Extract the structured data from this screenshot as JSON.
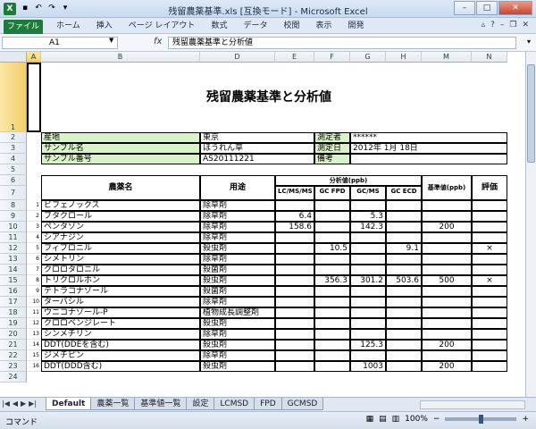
{
  "window": {
    "title": "残留農薬基準.xls [互換モード] - Microsoft Excel",
    "app_icon": "X"
  },
  "ribbon": {
    "file": "ファイル",
    "tabs": [
      "ホーム",
      "挿入",
      "ページ レイアウト",
      "数式",
      "データ",
      "校閲",
      "表示",
      "開発"
    ]
  },
  "formula_bar": {
    "cell_ref": "A1",
    "fx": "fx",
    "content": "残留農薬基準と分析値"
  },
  "columns": [
    "A",
    "B",
    "D",
    "E",
    "F",
    "G",
    "H",
    "M",
    "N"
  ],
  "rows": [
    "1",
    "2",
    "3",
    "4",
    "5",
    "6",
    "7",
    "8",
    "9",
    "10",
    "11",
    "12",
    "13",
    "14",
    "15",
    "16",
    "17",
    "18",
    "19",
    "20",
    "21",
    "22",
    "23",
    "24"
  ],
  "sheet": {
    "title": "残留農薬基準と分析値",
    "info": {
      "origin_label": "産地",
      "origin": "東京",
      "measurer_label": "測定者",
      "measurer": "******",
      "sample_name_label": "サンプル名",
      "sample_name": "ほうれん草",
      "date_label": "測定日",
      "date": "2012年  1月  18日",
      "sample_no_label": "サンプル番号",
      "sample_no": "AS20111221",
      "remarks_label": "備考",
      "remarks": ""
    },
    "headers": {
      "pesticide": "農薬名",
      "usage": "用途",
      "analysis": "分析値(ppb)",
      "lcms": "LC/MS/MS",
      "gcfpd": "GC FPD",
      "gcms": "GC/MS",
      "gcecd": "GC ECD",
      "standard": "基準値(ppb)",
      "evaluation": "評価"
    },
    "items": [
      {
        "no": "1",
        "name": "ビフェノックス",
        "usage": "除草剤",
        "lcms": "",
        "gcfpd": "",
        "gcms": "",
        "gcecd": "",
        "std": "",
        "eval": ""
      },
      {
        "no": "2",
        "name": "ブタクロール",
        "usage": "除草剤",
        "lcms": "6.4",
        "gcfpd": "",
        "gcms": "5.3",
        "gcecd": "",
        "std": "",
        "eval": ""
      },
      {
        "no": "3",
        "name": "ペンタゾン",
        "usage": "除草剤",
        "lcms": "158.6",
        "gcfpd": "",
        "gcms": "142.3",
        "gcecd": "",
        "std": "200",
        "eval": ""
      },
      {
        "no": "4",
        "name": "シアナジン",
        "usage": "除草剤",
        "lcms": "",
        "gcfpd": "",
        "gcms": "",
        "gcecd": "",
        "std": "",
        "eval": ""
      },
      {
        "no": "5",
        "name": "フィプロニル",
        "usage": "殺虫剤",
        "lcms": "",
        "gcfpd": "10.5",
        "gcms": "",
        "gcecd": "9.1",
        "std": "",
        "eval": "×"
      },
      {
        "no": "6",
        "name": "シメトリン",
        "usage": "除草剤",
        "lcms": "",
        "gcfpd": "",
        "gcms": "",
        "gcecd": "",
        "std": "",
        "eval": ""
      },
      {
        "no": "7",
        "name": "クロロタロニル",
        "usage": "殺菌剤",
        "lcms": "",
        "gcfpd": "",
        "gcms": "",
        "gcecd": "",
        "std": "",
        "eval": ""
      },
      {
        "no": "8",
        "name": "トリクロルホン",
        "usage": "殺虫剤",
        "lcms": "",
        "gcfpd": "356.3",
        "gcms": "301.2",
        "gcecd": "503.6",
        "std": "500",
        "eval": "×"
      },
      {
        "no": "9",
        "name": "テトラコナゾール",
        "usage": "殺菌剤",
        "lcms": "",
        "gcfpd": "",
        "gcms": "",
        "gcecd": "",
        "std": "",
        "eval": ""
      },
      {
        "no": "10",
        "name": "ターバシル",
        "usage": "除草剤",
        "lcms": "",
        "gcfpd": "",
        "gcms": "",
        "gcecd": "",
        "std": "",
        "eval": ""
      },
      {
        "no": "11",
        "name": "ウニコナゾール-P",
        "usage": "植物成長調整剤",
        "lcms": "",
        "gcfpd": "",
        "gcms": "",
        "gcecd": "",
        "std": "",
        "eval": ""
      },
      {
        "no": "12",
        "name": "クロロベンジレート",
        "usage": "殺虫剤",
        "lcms": "",
        "gcfpd": "",
        "gcms": "",
        "gcecd": "",
        "std": "",
        "eval": ""
      },
      {
        "no": "13",
        "name": "シンメチリン",
        "usage": "除草剤",
        "lcms": "",
        "gcfpd": "",
        "gcms": "",
        "gcecd": "",
        "std": "",
        "eval": ""
      },
      {
        "no": "14",
        "name": "DDT(DDEを含む)",
        "usage": "殺虫剤",
        "lcms": "",
        "gcfpd": "",
        "gcms": "125.3",
        "gcecd": "",
        "std": "200",
        "eval": ""
      },
      {
        "no": "15",
        "name": "ジメチピン",
        "usage": "除草剤",
        "lcms": "",
        "gcfpd": "",
        "gcms": "",
        "gcecd": "",
        "std": "",
        "eval": ""
      },
      {
        "no": "16",
        "name": "DDT(DDD含む)",
        "usage": "殺虫剤",
        "lcms": "",
        "gcfpd": "",
        "gcms": "1003",
        "gcecd": "",
        "std": "200",
        "eval": ""
      }
    ]
  },
  "sheet_tabs": [
    "Default",
    "農薬一覧",
    "基準値一覧",
    "設定",
    "LCMSD",
    "FPD",
    "GCMSD"
  ],
  "active_sheet_tab": "Default",
  "status": {
    "mode": "コマンド",
    "zoom": "100%",
    "zoom_minus": "−",
    "zoom_plus": "+"
  }
}
